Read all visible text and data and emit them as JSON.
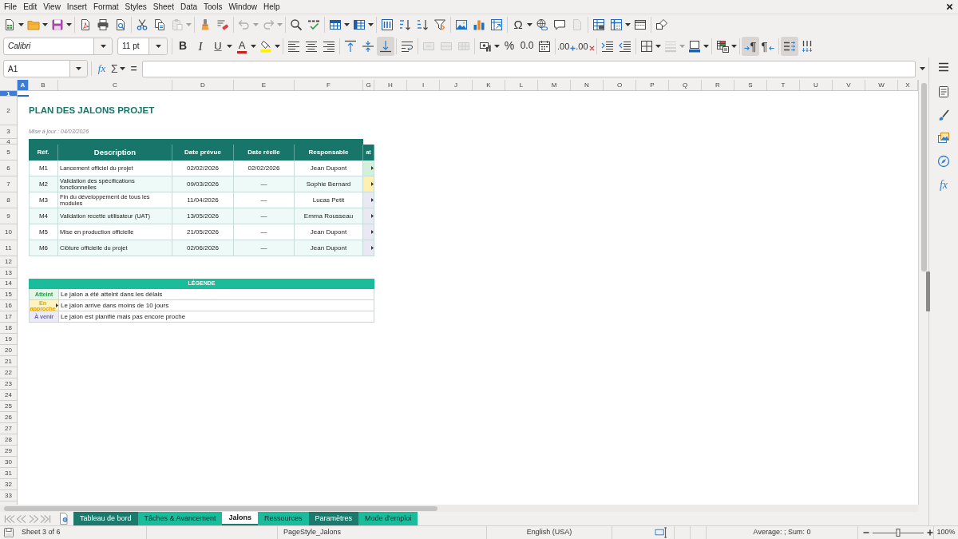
{
  "menu_bar": [
    "File",
    "Edit",
    "View",
    "Insert",
    "Format",
    "Styles",
    "Sheet",
    "Data",
    "Tools",
    "Window",
    "Help"
  ],
  "toolbars": [
    [
      {
        "kind": "new",
        "dropdown": true,
        "disabled": false,
        "pressed": false
      },
      {
        "kind": "open",
        "dropdown": true,
        "disabled": false,
        "pressed": false
      },
      {
        "kind": "save",
        "dropdown": true,
        "disabled": false,
        "pressed": false
      },
      {
        "kind": "separator"
      },
      {
        "kind": "pdf",
        "dropdown": false,
        "disabled": false,
        "pressed": false
      },
      {
        "kind": "print",
        "dropdown": false,
        "disabled": false,
        "pressed": false
      },
      {
        "kind": "preview",
        "dropdown": false,
        "disabled": false,
        "pressed": false
      },
      {
        "kind": "separator"
      },
      {
        "kind": "cut",
        "dropdown": false,
        "disabled": false,
        "pressed": false
      },
      {
        "kind": "copy",
        "dropdown": false,
        "disabled": false,
        "pressed": false
      },
      {
        "kind": "paste",
        "dropdown": true,
        "disabled": true,
        "pressed": false
      },
      {
        "kind": "separator"
      },
      {
        "kind": "clone",
        "dropdown": false,
        "disabled": false,
        "pressed": false
      },
      {
        "kind": "clear",
        "dropdown": false,
        "disabled": false,
        "pressed": false
      },
      {
        "kind": "separator"
      },
      {
        "kind": "undo",
        "dropdown": true,
        "disabled": true,
        "pressed": false
      },
      {
        "kind": "redo",
        "dropdown": true,
        "disabled": true,
        "pressed": false
      },
      {
        "kind": "separator"
      },
      {
        "kind": "find",
        "dropdown": false,
        "disabled": false,
        "pressed": false
      },
      {
        "kind": "spell",
        "dropdown": false,
        "disabled": false,
        "pressed": false
      },
      {
        "kind": "separator"
      },
      {
        "kind": "rows",
        "dropdown": true,
        "disabled": false,
        "pressed": false
      },
      {
        "kind": "cols",
        "dropdown": true,
        "disabled": false,
        "pressed": false
      },
      {
        "kind": "separator"
      },
      {
        "kind": "sort",
        "dropdown": false,
        "disabled": false,
        "pressed": false
      },
      {
        "kind": "sort_asc",
        "dropdown": false,
        "disabled": false,
        "pressed": false
      },
      {
        "kind": "sort_desc",
        "dropdown": false,
        "disabled": false,
        "pressed": false
      },
      {
        "kind": "filter",
        "dropdown": false,
        "disabled": false,
        "pressed": false
      },
      {
        "kind": "separator"
      },
      {
        "kind": "image",
        "dropdown": false,
        "disabled": false,
        "pressed": false
      },
      {
        "kind": "chart",
        "dropdown": false,
        "disabled": false,
        "pressed": false
      },
      {
        "kind": "pivot",
        "dropdown": false,
        "disabled": false,
        "pressed": false
      },
      {
        "kind": "separator"
      },
      {
        "kind": "special_char",
        "label": "Ω",
        "dropdown": true,
        "disabled": false,
        "pressed": false
      },
      {
        "kind": "hyperlink",
        "dropdown": false,
        "disabled": false,
        "pressed": false
      },
      {
        "kind": "comment",
        "dropdown": false,
        "disabled": false,
        "pressed": false
      },
      {
        "kind": "header_footer",
        "dropdown": false,
        "disabled": true,
        "pressed": false
      },
      {
        "kind": "separator"
      },
      {
        "kind": "print_range",
        "dropdown": false,
        "disabled": false,
        "pressed": false
      },
      {
        "kind": "freeze",
        "dropdown": true,
        "disabled": false,
        "pressed": false
      },
      {
        "kind": "split",
        "dropdown": false,
        "disabled": false,
        "pressed": false
      },
      {
        "kind": "separator"
      },
      {
        "kind": "shapes",
        "dropdown": false,
        "disabled": false,
        "pressed": false
      }
    ],
    [
      {
        "kind": "font_name",
        "value": "Calibri"
      },
      {
        "kind": "font_size",
        "value": "11 pt"
      },
      {
        "kind": "separator"
      },
      {
        "kind": "bold",
        "label": "B",
        "dropdown": false,
        "disabled": false,
        "pressed": false
      },
      {
        "kind": "italic",
        "label": "I",
        "dropdown": false,
        "disabled": false,
        "pressed": false
      },
      {
        "kind": "underline",
        "label": "U",
        "dropdown": true,
        "disabled": false,
        "pressed": false
      },
      {
        "kind": "font_color",
        "label": "A",
        "dropdown": true,
        "disabled": false,
        "pressed": false
      },
      {
        "kind": "highlight",
        "dropdown": true,
        "disabled": false,
        "pressed": false
      },
      {
        "kind": "separator"
      },
      {
        "kind": "align_left",
        "dropdown": false,
        "disabled": false,
        "pressed": false
      },
      {
        "kind": "align_center",
        "dropdown": false,
        "disabled": false,
        "pressed": false
      },
      {
        "kind": "align_right",
        "dropdown": false,
        "disabled": false,
        "pressed": false
      },
      {
        "kind": "separator"
      },
      {
        "kind": "align_top",
        "dropdown": false,
        "disabled": false,
        "pressed": false
      },
      {
        "kind": "align_middle",
        "dropdown": false,
        "disabled": false,
        "pressed": false
      },
      {
        "kind": "align_bottom",
        "dropdown": false,
        "disabled": false,
        "pressed": true
      },
      {
        "kind": "separator"
      },
      {
        "kind": "wrap",
        "dropdown": false,
        "disabled": false,
        "pressed": false
      },
      {
        "kind": "separator"
      },
      {
        "kind": "merge_center",
        "dropdown": false,
        "disabled": true,
        "pressed": false
      },
      {
        "kind": "merge",
        "dropdown": false,
        "disabled": true,
        "pressed": false
      },
      {
        "kind": "unmerge",
        "dropdown": false,
        "disabled": true,
        "pressed": false
      },
      {
        "kind": "separator"
      },
      {
        "kind": "currency",
        "dropdown": true,
        "disabled": false,
        "pressed": false
      },
      {
        "kind": "percent",
        "label": "%",
        "dropdown": false,
        "disabled": false,
        "pressed": false
      },
      {
        "kind": "number",
        "label": "0.0",
        "dropdown": false,
        "disabled": false,
        "pressed": false
      },
      {
        "kind": "date",
        "dropdown": false,
        "disabled": false,
        "pressed": false
      },
      {
        "kind": "separator"
      },
      {
        "kind": "add_decimal",
        "label": ".00",
        "dropdown": false,
        "disabled": false,
        "pressed": false
      },
      {
        "kind": "delete_decimal",
        "label": ".00",
        "dropdown": false,
        "disabled": false,
        "pressed": false
      },
      {
        "kind": "separator"
      },
      {
        "kind": "indent",
        "dropdown": false,
        "disabled": false,
        "pressed": false
      },
      {
        "kind": "outdent",
        "dropdown": false,
        "disabled": false,
        "pressed": false
      },
      {
        "kind": "separator"
      },
      {
        "kind": "borders",
        "dropdown": true,
        "disabled": false,
        "pressed": false
      },
      {
        "kind": "border_style",
        "dropdown": true,
        "disabled": true,
        "pressed": false
      },
      {
        "kind": "border_color",
        "dropdown": true,
        "disabled": false,
        "pressed": false
      },
      {
        "kind": "separator"
      },
      {
        "kind": "conditional",
        "dropdown": true,
        "disabled": false,
        "pressed": false
      },
      {
        "kind": "separator"
      },
      {
        "kind": "ltr",
        "label": "¶",
        "dropdown": false,
        "disabled": false,
        "pressed": true
      },
      {
        "kind": "rtl",
        "label": "¶",
        "dropdown": false,
        "disabled": false,
        "pressed": false
      },
      {
        "kind": "separator"
      },
      {
        "kind": "text_horizontal",
        "dropdown": false,
        "disabled": false,
        "pressed": true
      },
      {
        "kind": "text_vertical",
        "dropdown": false,
        "disabled": false,
        "pressed": false
      }
    ]
  ],
  "formula_bar": {
    "cell_reference": "A1",
    "function_wizard": "fx",
    "sum": "Σ",
    "equals": "="
  },
  "sidebar": [
    {
      "kind": "menu"
    },
    {
      "kind": "properties"
    },
    {
      "kind": "styles"
    },
    {
      "kind": "gallery"
    },
    {
      "kind": "navigator"
    },
    {
      "kind": "functions",
      "label": "fx"
    }
  ],
  "sheet": {
    "columns": [
      {
        "label": "A",
        "selected": true
      },
      {
        "label": "B",
        "selected": false
      },
      {
        "label": "C",
        "selected": false
      },
      {
        "label": "D",
        "selected": false
      },
      {
        "label": "E",
        "selected": false
      },
      {
        "label": "F",
        "selected": false
      },
      {
        "label": "G",
        "selected": false
      },
      {
        "label": "H",
        "selected": false
      },
      {
        "label": "I",
        "selected": false
      },
      {
        "label": "J",
        "selected": false
      },
      {
        "label": "K",
        "selected": false
      },
      {
        "label": "L",
        "selected": false
      },
      {
        "label": "M",
        "selected": false
      },
      {
        "label": "N",
        "selected": false
      },
      {
        "label": "O",
        "selected": false
      },
      {
        "label": "P",
        "selected": false
      },
      {
        "label": "Q",
        "selected": false
      },
      {
        "label": "R",
        "selected": false
      },
      {
        "label": "S",
        "selected": false
      },
      {
        "label": "T",
        "selected": false
      },
      {
        "label": "U",
        "selected": false
      },
      {
        "label": "V",
        "selected": false
      },
      {
        "label": "W",
        "selected": false
      },
      {
        "label": "X",
        "selected": false
      }
    ],
    "rows": [
      {
        "label": "1",
        "selected": true
      },
      {
        "label": "2",
        "selected": false
      },
      {
        "label": "3",
        "selected": false
      },
      {
        "label": "4",
        "selected": false
      },
      {
        "label": "5",
        "selected": false
      },
      {
        "label": "6",
        "selected": false
      },
      {
        "label": "7",
        "selected": false
      },
      {
        "label": "8",
        "selected": false
      },
      {
        "label": "9",
        "selected": false
      },
      {
        "label": "10",
        "selected": false
      },
      {
        "label": "11",
        "selected": false
      },
      {
        "label": "12",
        "selected": false
      },
      {
        "label": "13",
        "selected": false
      },
      {
        "label": "14",
        "selected": false
      },
      {
        "label": "15",
        "selected": false
      },
      {
        "label": "16",
        "selected": false
      },
      {
        "label": "17",
        "selected": false
      },
      {
        "label": "18",
        "selected": false
      },
      {
        "label": "19",
        "selected": false
      },
      {
        "label": "20",
        "selected": false
      },
      {
        "label": "21",
        "selected": false
      },
      {
        "label": "22",
        "selected": false
      },
      {
        "label": "23",
        "selected": false
      },
      {
        "label": "24",
        "selected": false
      },
      {
        "label": "25",
        "selected": false
      },
      {
        "label": "26",
        "selected": false
      },
      {
        "label": "27",
        "selected": false
      },
      {
        "label": "28",
        "selected": false
      },
      {
        "label": "29",
        "selected": false
      },
      {
        "label": "30",
        "selected": false
      },
      {
        "label": "31",
        "selected": false
      },
      {
        "label": "32",
        "selected": false
      },
      {
        "label": "33",
        "selected": false
      }
    ],
    "title": "PLAN DES JALONS PROJET",
    "updated": "Mise à jour : 04/03/2026",
    "milestones": {
      "columns": [
        "Réf.",
        "Description",
        "Date prévue",
        "Date réelle",
        "Responsable",
        "at"
      ],
      "rows": [
        {
          "ref": "M1",
          "description": "Lancement officiel du projet",
          "planned": "02/02/2026",
          "actual": "02/02/2026",
          "owner": "Jean Dupont",
          "color": "#d3f1da",
          "overflow": true
        },
        {
          "ref": "M2",
          "description": "Validation des spécifications fonctionnelles",
          "planned": "09/03/2026",
          "actual": "—",
          "owner": "Sophie Bernard",
          "color": "#fff0b0",
          "overflow": true
        },
        {
          "ref": "M3",
          "description": "Fin du développement de tous les modules",
          "planned": "11/04/2026",
          "actual": "—",
          "owner": "Lucas Petit",
          "color": "#e9e8f4",
          "overflow": true
        },
        {
          "ref": "M4",
          "description": "Validation recette utilisateur (UAT)",
          "planned": "13/05/2026",
          "actual": "—",
          "owner": "Emma Rousseau",
          "color": "#e9e8f4",
          "overflow": true
        },
        {
          "ref": "M5",
          "description": "Mise en production officielle",
          "planned": "21/05/2026",
          "actual": "—",
          "owner": "Jean Dupont",
          "color": "#e9e8f4",
          "overflow": true
        },
        {
          "ref": "M6",
          "description": "Clôture officielle du projet",
          "planned": "02/06/2026",
          "actual": "—",
          "owner": "Jean Dupont",
          "color": "#e9e8f4",
          "overflow": true
        }
      ]
    },
    "legend": {
      "title": "LÉGENDE",
      "items": [
        {
          "label": "Atteint",
          "label_style": {
            "color": "#2f9e50"
          },
          "color": "#e3f6e8",
          "overflow": false,
          "description": "Le jalon a été atteint dans les délais"
        },
        {
          "label": "En approche",
          "label_style": {
            "color": "#e0a400"
          },
          "color": "#fff4c2",
          "overflow": true,
          "description": "Le jalon arrive dans moins de 10 jours"
        },
        {
          "label": "À venir",
          "label_style": {
            "color": "#6b68b8"
          },
          "color": "#ebebf7",
          "overflow": false,
          "description": "Le jalon est planifié mais pas encore proche"
        }
      ]
    }
  },
  "sheet_tabs": [
    {
      "label": "Tableau de bord",
      "selected": false,
      "color": "#1b7a6c"
    },
    {
      "label": "Tâches & Avancement",
      "selected": false,
      "color": "#1abc9c"
    },
    {
      "label": "Jalons",
      "selected": true,
      "color": "#1b7a6c"
    },
    {
      "label": "Ressources",
      "selected": false,
      "color": "#1abc9c"
    },
    {
      "label": "Paramètres",
      "selected": false,
      "color": "#1b7a6c"
    },
    {
      "label": "Mode d'emploi",
      "selected": false,
      "color": "#1abc9c"
    }
  ],
  "status_bar": {
    "sheet": "Sheet 3 of 6",
    "page_style": "PageStyle_Jalons",
    "language": "English (USA)",
    "summary": "Average: ; Sum: 0",
    "zoom": {
      "level": 0.5
    },
    "zoom_percent": "100%"
  }
}
